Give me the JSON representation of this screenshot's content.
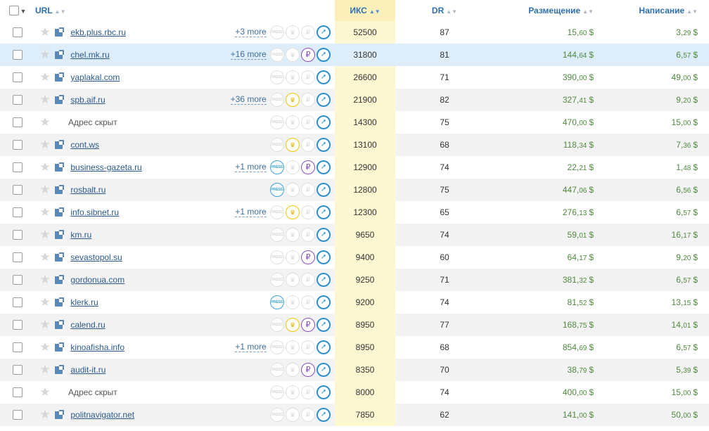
{
  "header": {
    "url": "URL",
    "iks": "ИКС",
    "dr": "DR",
    "placement": "Размещение",
    "writing": "Написание"
  },
  "currency": "$",
  "rows": [
    {
      "url": "ekb.plus.rbc.ru",
      "hidden": false,
      "more": "+3 more",
      "press": false,
      "crown": false,
      "rub": false,
      "iks": "52500",
      "dr": "87",
      "place_i": "15,",
      "place_d": "60",
      "write_i": "3,",
      "write_d": "29",
      "highlight": false
    },
    {
      "url": "chel.mk.ru",
      "hidden": false,
      "more": "+16 more",
      "press": false,
      "crown": false,
      "rub": true,
      "iks": "31800",
      "dr": "81",
      "place_i": "144,",
      "place_d": "64",
      "write_i": "6,",
      "write_d": "57",
      "highlight": true
    },
    {
      "url": "yaplakal.com",
      "hidden": false,
      "more": "",
      "press": false,
      "crown": false,
      "rub": false,
      "iks": "26600",
      "dr": "71",
      "place_i": "390,",
      "place_d": "00",
      "write_i": "49,",
      "write_d": "00",
      "highlight": false
    },
    {
      "url": "spb.aif.ru",
      "hidden": false,
      "more": "+36 more",
      "press": false,
      "crown": true,
      "rub": false,
      "iks": "21900",
      "dr": "82",
      "place_i": "327,",
      "place_d": "41",
      "write_i": "9,",
      "write_d": "20",
      "highlight": false
    },
    {
      "url": "Адрес скрыт",
      "hidden": true,
      "more": "",
      "press": false,
      "crown": false,
      "rub": false,
      "iks": "14300",
      "dr": "75",
      "place_i": "470,",
      "place_d": "00",
      "write_i": "15,",
      "write_d": "00",
      "highlight": false
    },
    {
      "url": "cont.ws",
      "hidden": false,
      "more": "",
      "press": false,
      "crown": true,
      "rub": false,
      "iks": "13100",
      "dr": "68",
      "place_i": "118,",
      "place_d": "34",
      "write_i": "7,",
      "write_d": "36",
      "highlight": false
    },
    {
      "url": "business-gazeta.ru",
      "hidden": false,
      "more": "+1 more",
      "press": true,
      "crown": false,
      "rub": true,
      "iks": "12900",
      "dr": "74",
      "place_i": "22,",
      "place_d": "21",
      "write_i": "1,",
      "write_d": "48",
      "highlight": false
    },
    {
      "url": "rosbalt.ru",
      "hidden": false,
      "more": "",
      "press": true,
      "crown": false,
      "rub": false,
      "iks": "12800",
      "dr": "75",
      "place_i": "447,",
      "place_d": "06",
      "write_i": "6,",
      "write_d": "56",
      "highlight": false
    },
    {
      "url": "info.sibnet.ru",
      "hidden": false,
      "more": "+1 more",
      "press": false,
      "crown": true,
      "rub": false,
      "iks": "12300",
      "dr": "65",
      "place_i": "276,",
      "place_d": "13",
      "write_i": "6,",
      "write_d": "57",
      "highlight": false
    },
    {
      "url": "km.ru",
      "hidden": false,
      "more": "",
      "press": false,
      "crown": false,
      "rub": false,
      "iks": "9650",
      "dr": "74",
      "place_i": "59,",
      "place_d": "01",
      "write_i": "16,",
      "write_d": "17",
      "highlight": false
    },
    {
      "url": "sevastopol.su",
      "hidden": false,
      "more": "",
      "press": false,
      "crown": false,
      "rub": true,
      "iks": "9400",
      "dr": "60",
      "place_i": "64,",
      "place_d": "17",
      "write_i": "9,",
      "write_d": "20",
      "highlight": false
    },
    {
      "url": "gordonua.com",
      "hidden": false,
      "more": "",
      "press": false,
      "crown": false,
      "rub": false,
      "iks": "9250",
      "dr": "71",
      "place_i": "381,",
      "place_d": "32",
      "write_i": "6,",
      "write_d": "57",
      "highlight": false
    },
    {
      "url": "klerk.ru",
      "hidden": false,
      "more": "",
      "press": true,
      "crown": false,
      "rub": false,
      "iks": "9200",
      "dr": "74",
      "place_i": "81,",
      "place_d": "52",
      "write_i": "13,",
      "write_d": "15",
      "highlight": false
    },
    {
      "url": "calend.ru",
      "hidden": false,
      "more": "",
      "press": false,
      "crown": true,
      "rub": true,
      "iks": "8950",
      "dr": "77",
      "place_i": "168,",
      "place_d": "75",
      "write_i": "14,",
      "write_d": "01",
      "highlight": false
    },
    {
      "url": "kinoafisha.info",
      "hidden": false,
      "more": "+1 more",
      "press": false,
      "crown": false,
      "rub": false,
      "iks": "8950",
      "dr": "68",
      "place_i": "854,",
      "place_d": "69",
      "write_i": "6,",
      "write_d": "57",
      "highlight": false
    },
    {
      "url": "audit-it.ru",
      "hidden": false,
      "more": "",
      "press": false,
      "crown": false,
      "rub": true,
      "iks": "8350",
      "dr": "70",
      "place_i": "38,",
      "place_d": "79",
      "write_i": "5,",
      "write_d": "39",
      "highlight": false
    },
    {
      "url": "Адрес скрыт",
      "hidden": true,
      "more": "",
      "press": false,
      "crown": false,
      "rub": false,
      "iks": "8000",
      "dr": "74",
      "place_i": "400,",
      "place_d": "00",
      "write_i": "15,",
      "write_d": "00",
      "highlight": false
    },
    {
      "url": "politnavigator.net",
      "hidden": false,
      "more": "",
      "press": false,
      "crown": false,
      "rub": false,
      "iks": "7850",
      "dr": "62",
      "place_i": "141,",
      "place_d": "00",
      "write_i": "50,",
      "write_d": "00",
      "highlight": false
    }
  ]
}
